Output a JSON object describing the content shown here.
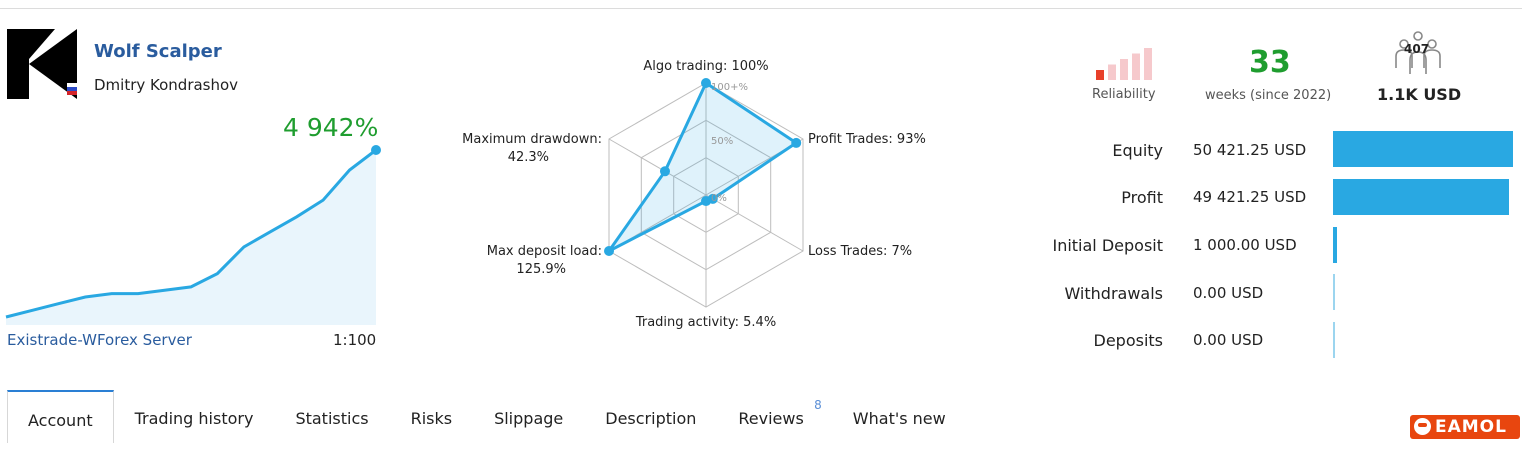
{
  "signal": {
    "name": "Wolf Scalper",
    "author": "Dmitry Kondrashov",
    "growth": "4 942%",
    "server": "Existrade-WForex Server",
    "leverage": "1:100"
  },
  "growth_chart": {
    "values": [
      0,
      4,
      8,
      12,
      14,
      14,
      16,
      18,
      26,
      42,
      51,
      60,
      70,
      88,
      100
    ]
  },
  "radar": {
    "scale_labels": [
      "100+%",
      "50%",
      "0%"
    ],
    "axes": [
      {
        "label": "Algo trading: 100%",
        "value": 100
      },
      {
        "label": "Profit Trades: 93%",
        "value": 93
      },
      {
        "label": "Loss Trades: 7%",
        "value": 7
      },
      {
        "label": "Trading activity: 5.4%",
        "value": 5.4
      },
      {
        "label_line1": "Max deposit load:",
        "label_line2": "125.9%",
        "value": 125.9
      },
      {
        "label_line1": "Maximum drawdown:",
        "label_line2": "42.3%",
        "value": 42.3
      }
    ]
  },
  "reliability": {
    "label": "Reliability",
    "level": 1,
    "bars": 5,
    "active_color": "#e8402a",
    "inactive_color": "#f6c9cc"
  },
  "weeks": {
    "value": "33",
    "label": "weeks (since 2022)"
  },
  "subscribers": {
    "count": "407",
    "price": "1.1K USD",
    "icon": "subscribers-icon"
  },
  "stats": [
    {
      "label": "Equity",
      "value": "50 421.25 USD",
      "bar_fraction": 1.0
    },
    {
      "label": "Profit",
      "value": "49 421.25 USD",
      "bar_fraction": 0.98
    },
    {
      "label": "Initial Deposit",
      "value": "1 000.00 USD",
      "bar_fraction": 0.02
    },
    {
      "label": "Withdrawals",
      "value": "0.00 USD",
      "bar_fraction": 0
    },
    {
      "label": "Deposits",
      "value": "0.00 USD",
      "bar_fraction": 0
    }
  ],
  "tabs": [
    {
      "label": "Account",
      "active": true
    },
    {
      "label": "Trading history"
    },
    {
      "label": "Statistics"
    },
    {
      "label": "Risks"
    },
    {
      "label": "Slippage"
    },
    {
      "label": "Description"
    },
    {
      "label": "Reviews",
      "badge": "8"
    },
    {
      "label": "What's new"
    }
  ],
  "watermark": "EAMOL",
  "colors": {
    "accent_blue": "#29a8e2",
    "growth_green": "#1f9d2f",
    "link_blue": "#2a5c9e"
  }
}
